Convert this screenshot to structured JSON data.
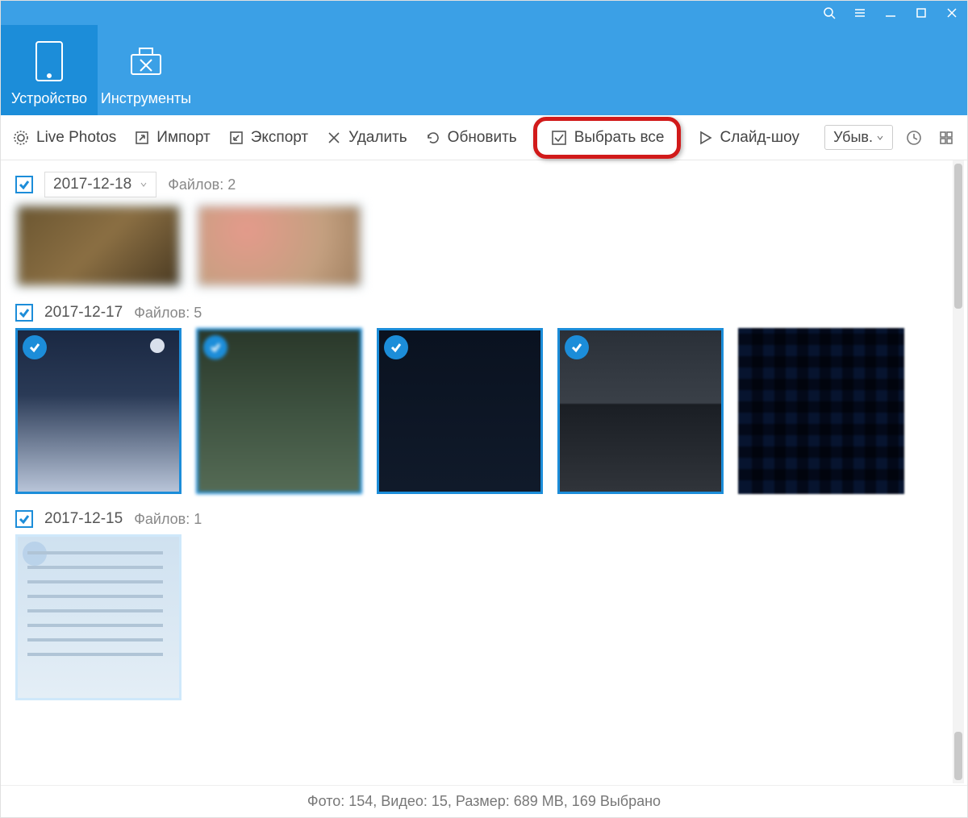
{
  "header": {
    "tab_device": "Устройство",
    "tab_tools": "Инструменты"
  },
  "toolbar": {
    "live_photos": "Live Photos",
    "import": "Импорт",
    "export": "Экспорт",
    "delete": "Удалить",
    "refresh": "Обновить",
    "select_all": "Выбрать все",
    "slideshow": "Слайд-шоу",
    "sort": "Убыв."
  },
  "groups": [
    {
      "date": "2017-12-18",
      "files_label": "Файлов: 2",
      "checked": true,
      "has_dropdown": true
    },
    {
      "date": "2017-12-17",
      "files_label": "Файлов: 5",
      "checked": true,
      "has_dropdown": false
    },
    {
      "date": "2017-12-15",
      "files_label": "Файлов: 1",
      "checked": true,
      "has_dropdown": false
    }
  ],
  "status": "Фото: 154, Видео: 15, Размер: 689 MB, 169 Выбрано"
}
